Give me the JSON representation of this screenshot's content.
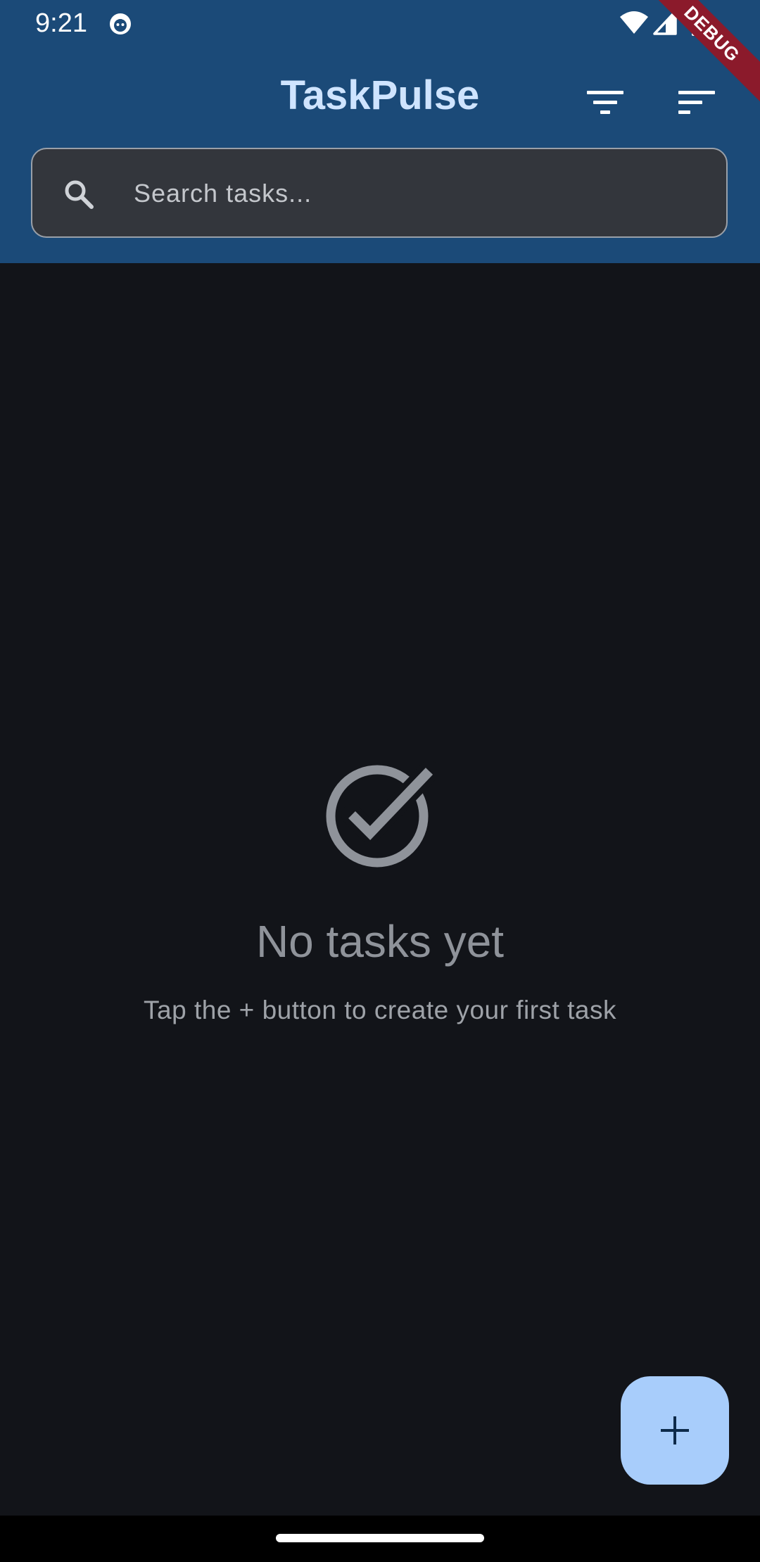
{
  "status_bar": {
    "time": "9:21",
    "icons": [
      "app-notification-icon",
      "wifi-icon",
      "signal-icon",
      "battery-icon"
    ]
  },
  "debug_banner": "DEBUG",
  "app_bar": {
    "title": "TaskPulse",
    "actions": [
      "filter-icon",
      "sort-icon"
    ]
  },
  "search": {
    "placeholder": "Search tasks...",
    "value": ""
  },
  "empty_state": {
    "icon": "check-circle-icon",
    "title": "No tasks yet",
    "subtitle": "Tap the + button to create your first task"
  },
  "fab": {
    "icon": "plus-icon"
  },
  "colors": {
    "header_bg": "#1b4a78",
    "body_bg": "#121419",
    "title": "#cfe4ff",
    "fab_bg": "#a8cdfb",
    "search_bg": "#33363c",
    "debug_ribbon": "#8b1a2b"
  }
}
